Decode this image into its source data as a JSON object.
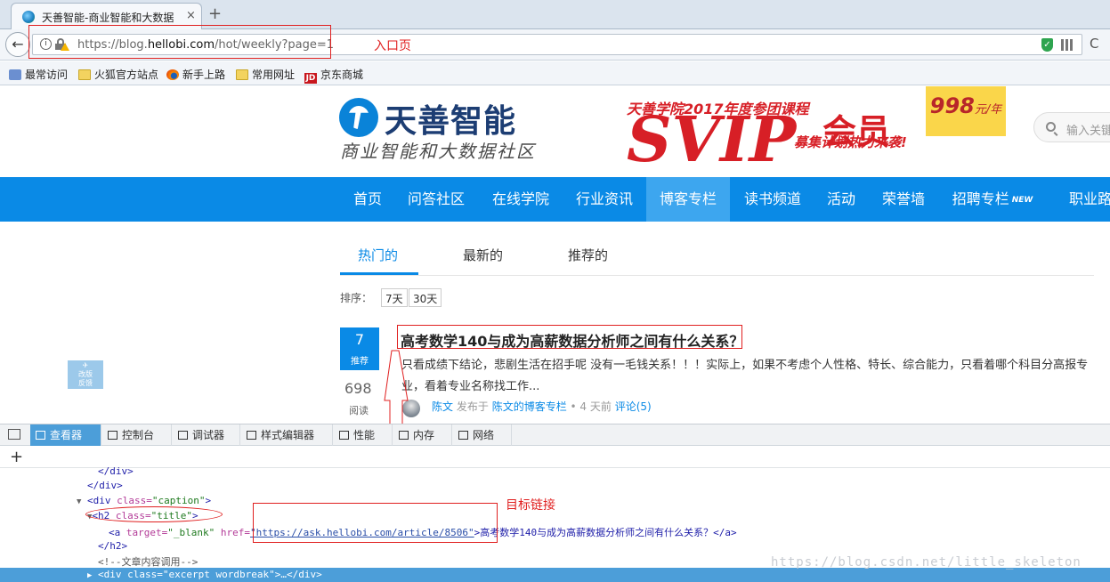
{
  "browser": {
    "tab_title": "天善智能-商业智能和大数据",
    "tab_close": "×",
    "new_tab": "+",
    "url_prefix": "https://blog.",
    "url_domain": "hellobi.com",
    "url_path": "/hot/weekly?page=1",
    "reload": "C",
    "bookmarks": [
      "最常访问",
      "火狐官方站点",
      "新手上路",
      "常用网址",
      "京东商城"
    ]
  },
  "annotations": {
    "entry_page": "入口页",
    "target_link": "目标链接"
  },
  "site": {
    "logo_name": "天善智能",
    "logo_slogan": "商业智能和大数据社区",
    "banner_top": "天善学院2017年度参团课程",
    "banner_svip": "SVIP",
    "banner_member": "会员",
    "banner_sub": "募集计划热力来袭!",
    "banner_price": "998",
    "banner_price_unit": "元/年",
    "search_placeholder": "输入关键",
    "nav": [
      "首页",
      "问答社区",
      "在线学院",
      "行业资讯",
      "博客专栏",
      "读书频道",
      "活动",
      "荣誉墙",
      "招聘专栏",
      "职业路"
    ],
    "nav_active": "博客专栏",
    "new_badge": "NEW",
    "content_tabs": [
      "热门的",
      "最新的",
      "推荐的"
    ],
    "sort_label": "排序：",
    "sort_options": [
      "7天",
      "30天"
    ],
    "feedback": "改版\n反馈"
  },
  "article": {
    "votes": "7",
    "votes_label": "推荐",
    "views": "698",
    "views_label": "阅读",
    "title": "高考数学140与成为高薪数据分析师之间有什么关系？",
    "excerpt": "只看成绩下结论，悲剧生活在招手呢 没有一毛钱关系！！！实际上，如果不考虑个人性格、特长、综合能力，只看着哪个科目分高报专业，看着专业名称找工作...",
    "author": "陈文",
    "published_in": "发布于",
    "column": "陈文的博客专栏",
    "time": "• 4 天前",
    "comments": "评论(5)"
  },
  "devtools": {
    "tabs": [
      "查看器",
      "控制台",
      "调试器",
      "样式编辑器",
      "性能",
      "内存",
      "网络"
    ],
    "active_tab": "查看器",
    "plus": "+",
    "code_lines": {
      "l1": "</div>",
      "l2": "</div>",
      "l3_tag_open": "<div ",
      "l3_attr": "class=",
      "l3_val": "\"caption\"",
      "l3_close": ">",
      "l4_tag_open": "<h2 ",
      "l4_attr": "class=",
      "l4_val": "\"title\"",
      "l4_close": ">",
      "l5_tag_open": "<a ",
      "l5_attr1": "target=",
      "l5_val1": "\"_blank\"",
      "l5_attr2": " href=",
      "l5_href": "\"https://ask.hellobi.com/article/8506\"",
      "l5_text": ">高考数学140与成为高薪数据分析师之间有什么关系？</a>",
      "l6": "</h2>",
      "l7": "<!--文章内容调用-->",
      "l8_tag_open": "<div ",
      "l8_attr": "class=",
      "l8_val": "\"excerpt wordbreak\"",
      "l8_rest": ">…</div>"
    }
  },
  "watermark": "https://blog.csdn.net/little_skeleton",
  "colors": {
    "brand_blue": "#0a8ae6",
    "annotation_red": "#e02020",
    "devtools_selected": "#4c9ed9"
  }
}
